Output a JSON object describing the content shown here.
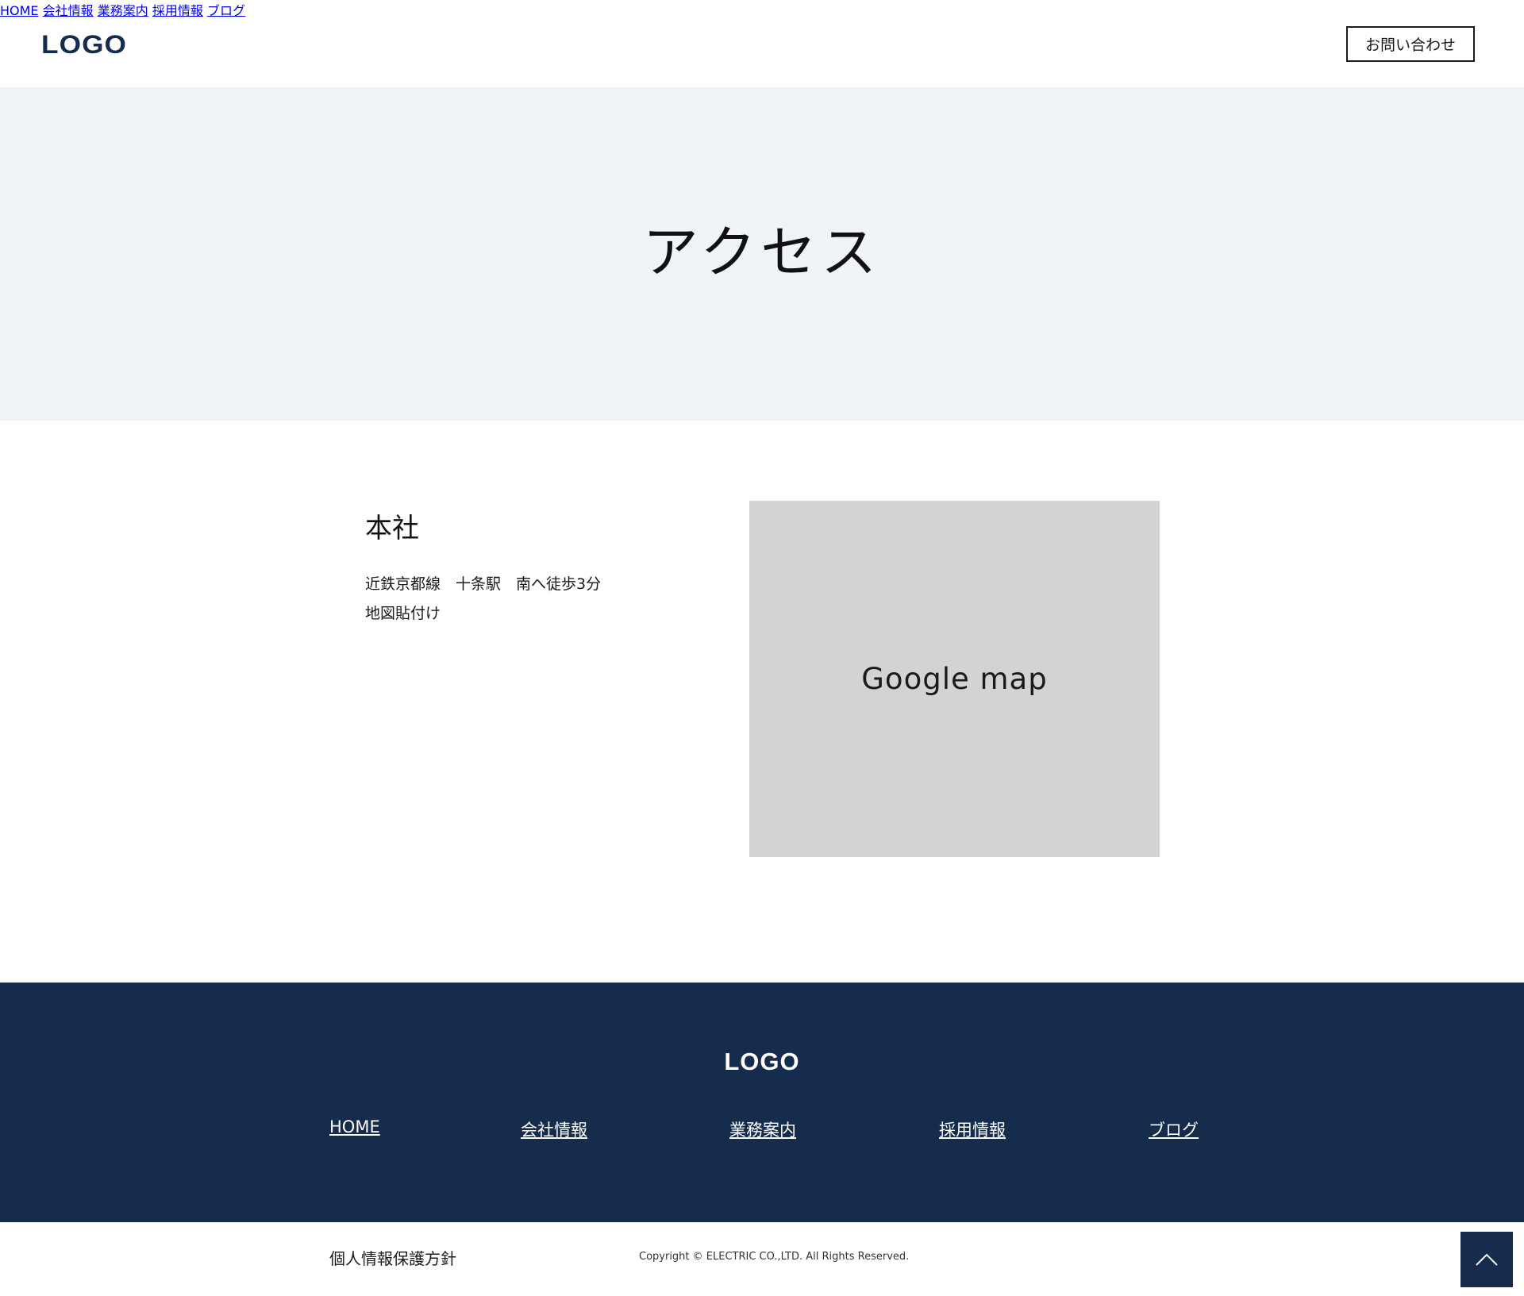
{
  "header": {
    "logo": "LOGO",
    "nav": [
      "HOME",
      "会社情報",
      "業務案内",
      "採用情報",
      "ブログ"
    ],
    "contact_label": "お問い合わせ"
  },
  "hero": {
    "title": "アクセス"
  },
  "office": {
    "name": "本社",
    "lines": [
      "近鉄京都線　十条駅　南へ徒歩3分",
      "地図貼付け"
    ]
  },
  "map": {
    "label": "Google map"
  },
  "footer": {
    "logo": "LOGO",
    "nav": [
      "HOME",
      "会社情報",
      "業務案内",
      "採用情報",
      "ブログ"
    ]
  },
  "bottom": {
    "privacy_label": "個人情報保護方針",
    "copyright": "Copyright © ELECTRIC CO.,LTD. All Rights Reserved."
  },
  "colors": {
    "navy": "#152c4c",
    "hero_bg": "#f0f4f9",
    "map_bg": "#d3d3d3"
  },
  "icons": {
    "back_to_top": "chevron-up-icon"
  }
}
